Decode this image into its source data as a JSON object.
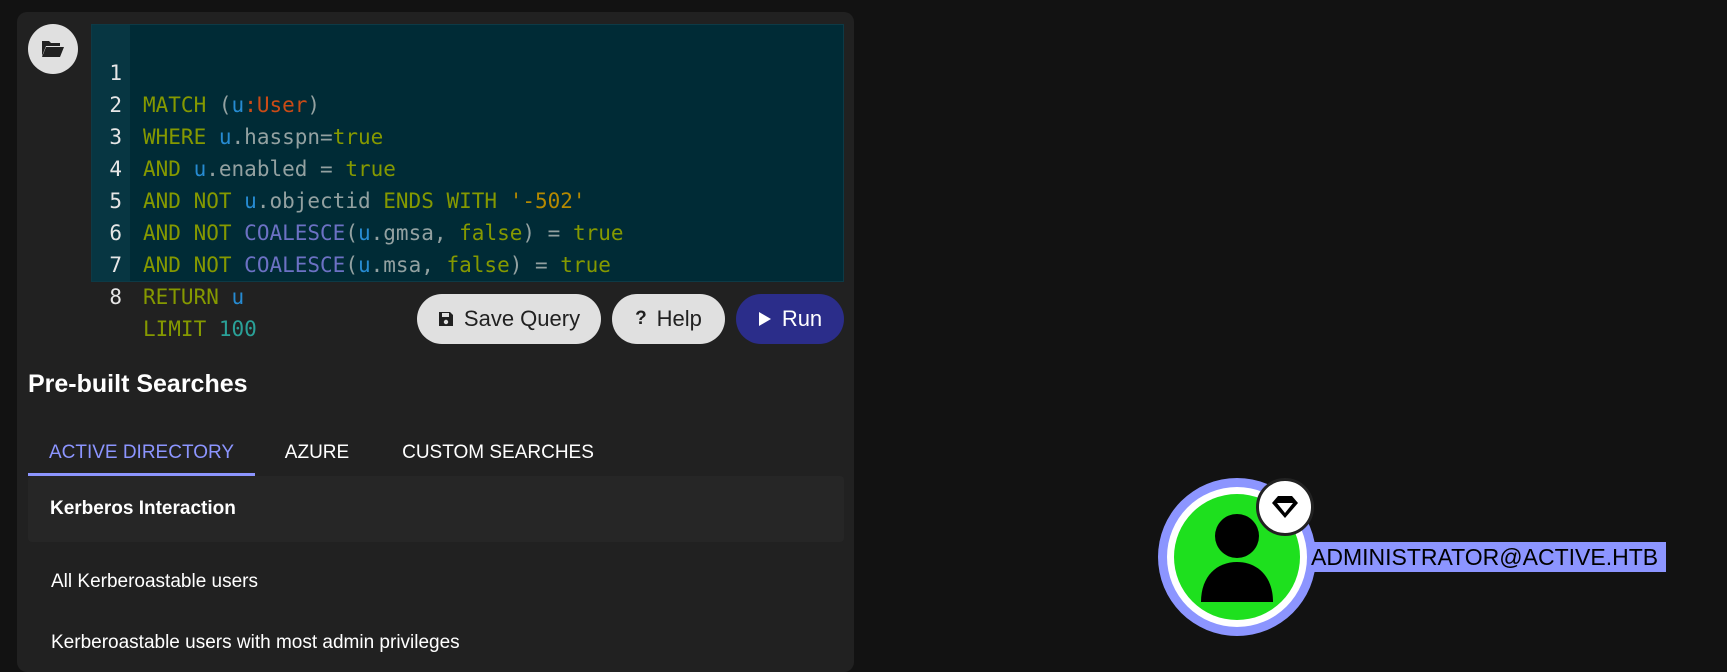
{
  "editor": {
    "lines": [
      {
        "n": "1"
      },
      {
        "n": "2"
      },
      {
        "n": "3"
      },
      {
        "n": "4"
      },
      {
        "n": "5"
      },
      {
        "n": "6"
      },
      {
        "n": "7"
      },
      {
        "n": "8"
      }
    ],
    "tokens": {
      "l1": [
        "MATCH",
        "(",
        "u",
        ":User",
        ")"
      ],
      "l2": [
        "WHERE",
        "u",
        ".hasspn=",
        "true"
      ],
      "l3": [
        "AND",
        "u",
        ".enabled = ",
        "true"
      ],
      "l4": [
        "AND NOT",
        "u",
        ".objectid ",
        "ENDS WITH",
        "'-502'"
      ],
      "l5": [
        "AND NOT",
        "COALESCE",
        "(",
        "u",
        ".gmsa, ",
        "false",
        ") = ",
        "true"
      ],
      "l6": [
        "AND NOT",
        "COALESCE",
        "(",
        "u",
        ".msa, ",
        "false",
        ") = ",
        "true"
      ],
      "l7": [
        "RETURN",
        "u"
      ],
      "l8": [
        "LIMIT",
        "100"
      ]
    }
  },
  "buttons": {
    "save": "Save Query",
    "help": "Help",
    "run": "Run"
  },
  "searches": {
    "title": "Pre-built Searches",
    "tabs": [
      "ACTIVE DIRECTORY",
      "AZURE",
      "CUSTOM SEARCHES"
    ],
    "active_tab": "ACTIVE DIRECTORY",
    "group": "Kerberos Interaction",
    "items": [
      "All Kerberoastable users",
      "Kerberoastable users with most admin privileges"
    ]
  },
  "graph": {
    "node_label": "ADMINISTRATOR@ACTIVE.HTB",
    "node_color": "#1ee01e",
    "highlight_color": "#8c95ff"
  },
  "icons": {
    "folder": "folder-open-icon",
    "save": "floppy-disk-icon",
    "help": "question-icon",
    "run": "play-icon",
    "user": "user-icon",
    "tier0": "gem-icon"
  }
}
